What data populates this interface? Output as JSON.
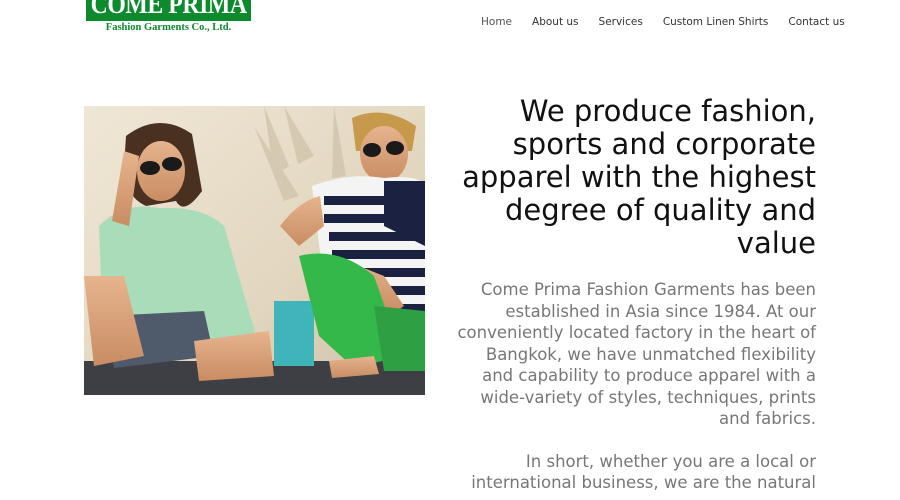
{
  "logo": {
    "title": "COME PRIMA",
    "subtitle": "Fashion Garments Co., Ltd."
  },
  "nav": {
    "items": [
      {
        "label": "Home"
      },
      {
        "label": "About us"
      },
      {
        "label": "Services"
      },
      {
        "label": "Custom Linen Shirts"
      },
      {
        "label": "Contact us"
      }
    ]
  },
  "hero": {
    "image_alt": "Two men in sunglasses sitting against a wall"
  },
  "content": {
    "headline": "We produce fashion, sports and corporate apparel with the highest degree of quality and value",
    "paragraph1": "Come Prima Fashion Garments has been established in Asia since 1984. At our conveniently located factory in the heart of Bangkok, we have unmatched flexibility and capability to produce apparel with a wide-variety of styles, techniques, prints and fabrics.",
    "paragraph2": "In short, whether you are a local or international business, we are the natural"
  },
  "colors": {
    "brand_green": "#0d8a2e",
    "headline": "#111111",
    "body_text": "#777777"
  }
}
